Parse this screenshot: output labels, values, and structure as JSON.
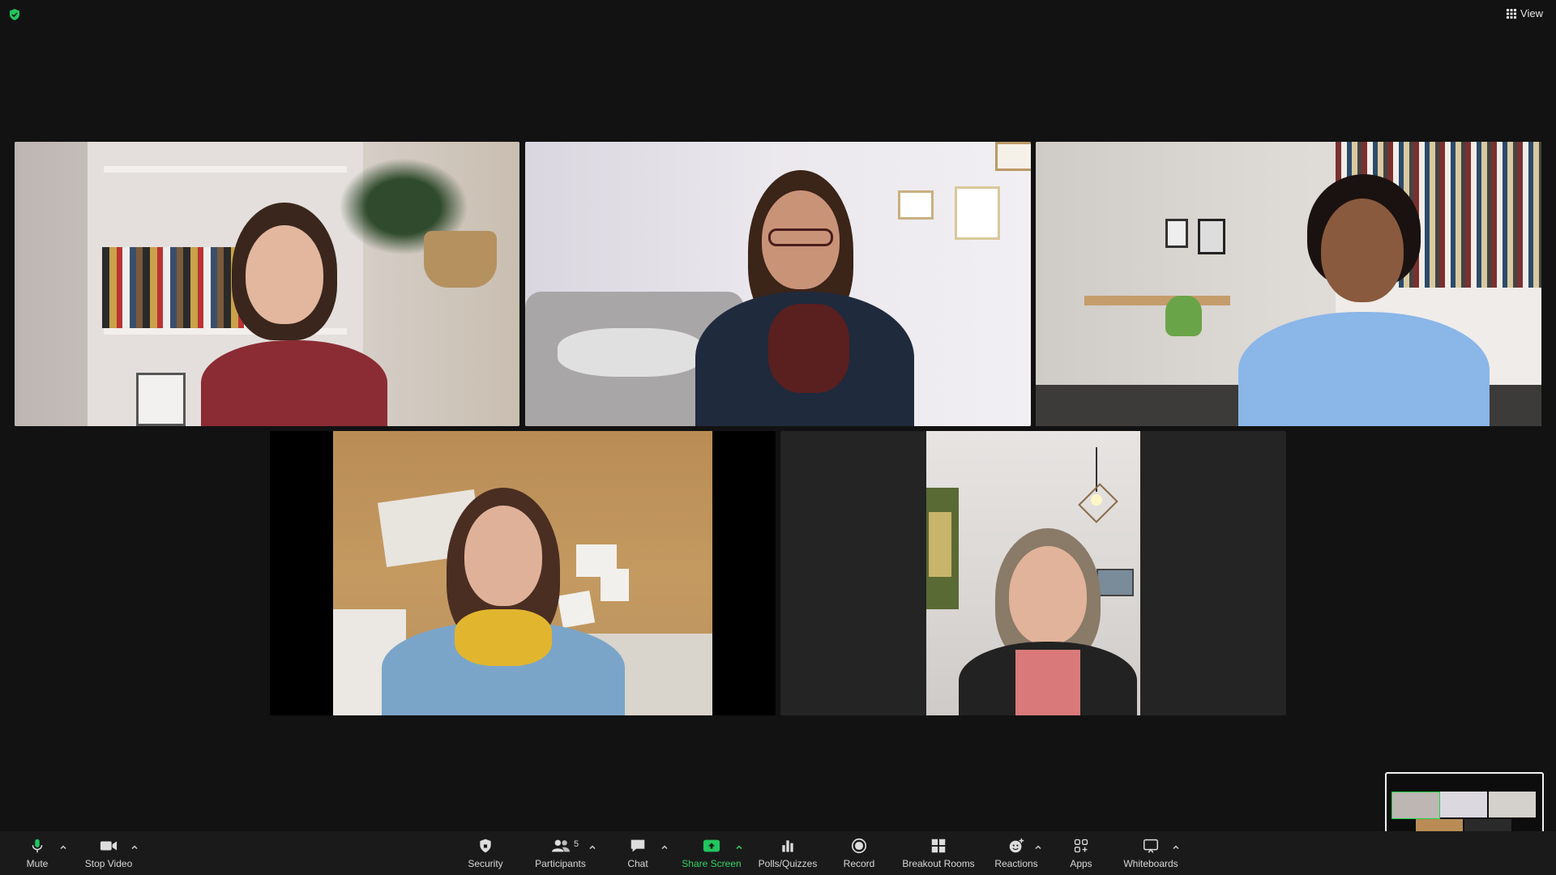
{
  "top_bar": {
    "view_label": "View"
  },
  "participants": [
    {
      "id": "p1",
      "active_speaker": true
    },
    {
      "id": "p2",
      "active_speaker": false
    },
    {
      "id": "p3",
      "active_speaker": false
    },
    {
      "id": "p4",
      "active_speaker": false
    },
    {
      "id": "p5",
      "active_speaker": false
    }
  ],
  "toolbar": {
    "mute": "Mute",
    "stop_video": "Stop Video",
    "security": "Security",
    "participants": "Participants",
    "participants_count": "5",
    "chat": "Chat",
    "share_screen": "Share Screen",
    "polls": "Polls/Quizzes",
    "record": "Record",
    "breakout": "Breakout Rooms",
    "reactions": "Reactions",
    "apps": "Apps",
    "whiteboards": "Whiteboards"
  },
  "colors": {
    "active_speaker_border": "#1fd14a",
    "share_screen_accent": "#2fd566",
    "background": "#121212",
    "toolbar_bg": "#1a1a1a"
  }
}
